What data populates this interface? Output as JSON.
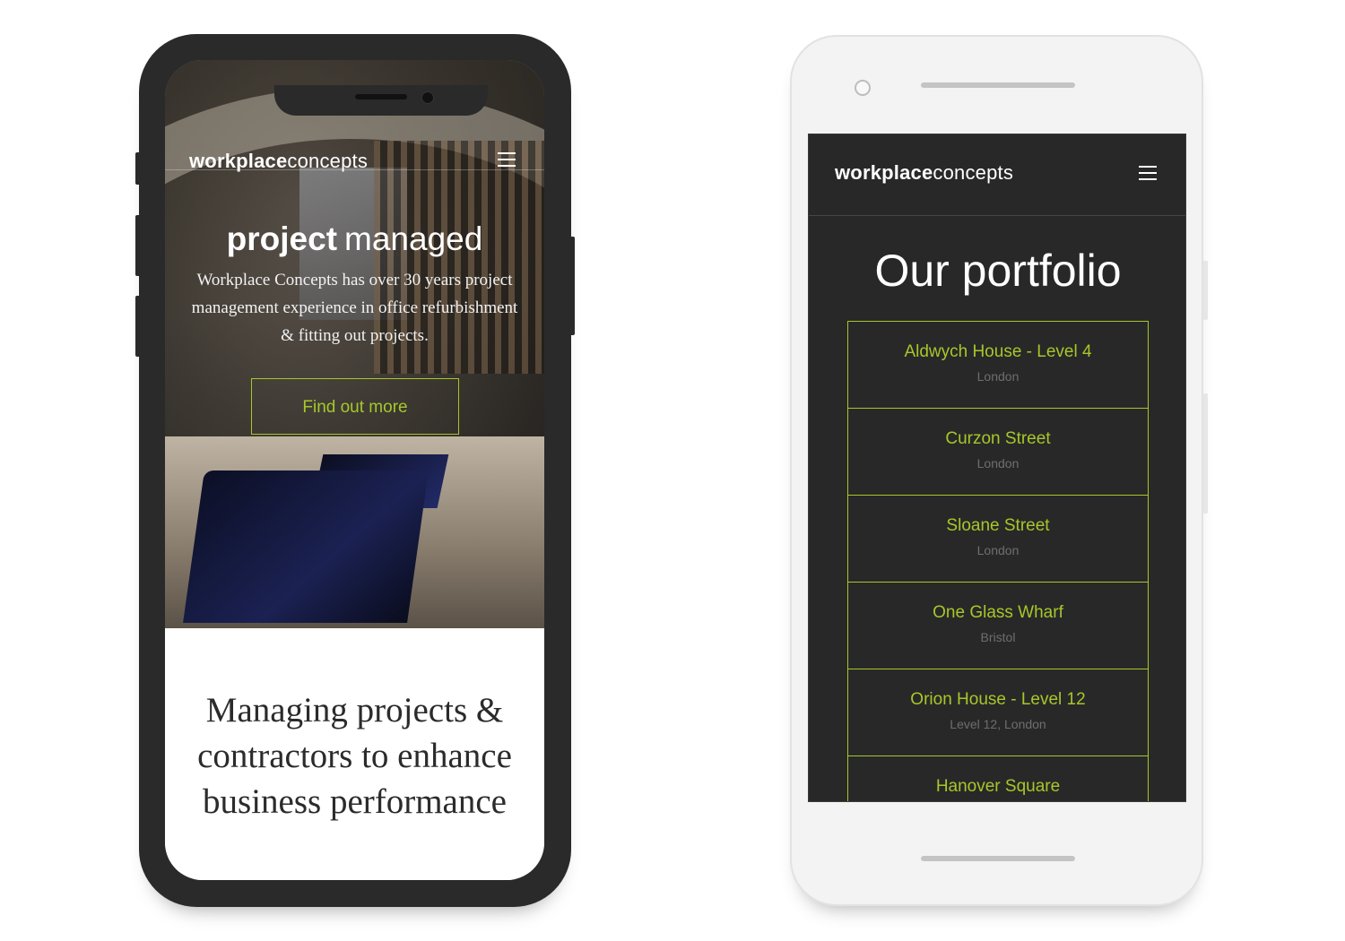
{
  "iphone": {
    "nav": {
      "brand_bold": "workplace",
      "brand_regular": "concepts",
      "menu_icon": "hamburger-icon"
    },
    "hero": {
      "title_bold": "project",
      "title_regular": "managed",
      "text": "Workplace Concepts has over 30 years project management experience in office refurbishment & fitting out projects.",
      "cta_label": "Find out more"
    },
    "lower": {
      "headline": "Managing projects & contractors to enhance business performance"
    }
  },
  "android": {
    "nav": {
      "brand_bold": "workplace",
      "brand_regular": "concepts",
      "menu_icon": "hamburger-icon"
    },
    "title": "Our portfolio",
    "portfolio": [
      {
        "name": "Aldwych House - Level 4",
        "location": "London"
      },
      {
        "name": "Curzon Street",
        "location": "London"
      },
      {
        "name": "Sloane Street",
        "location": "London"
      },
      {
        "name": "One Glass Wharf",
        "location": "Bristol"
      },
      {
        "name": "Orion House - Level 12",
        "location": "Level 12, London"
      },
      {
        "name": "Hanover Square",
        "location": ""
      }
    ]
  },
  "colors": {
    "accent": "#a6c72a",
    "dark_bg": "#282828",
    "device_dark": "#2a2a2a",
    "device_light": "#f3f3f3"
  }
}
